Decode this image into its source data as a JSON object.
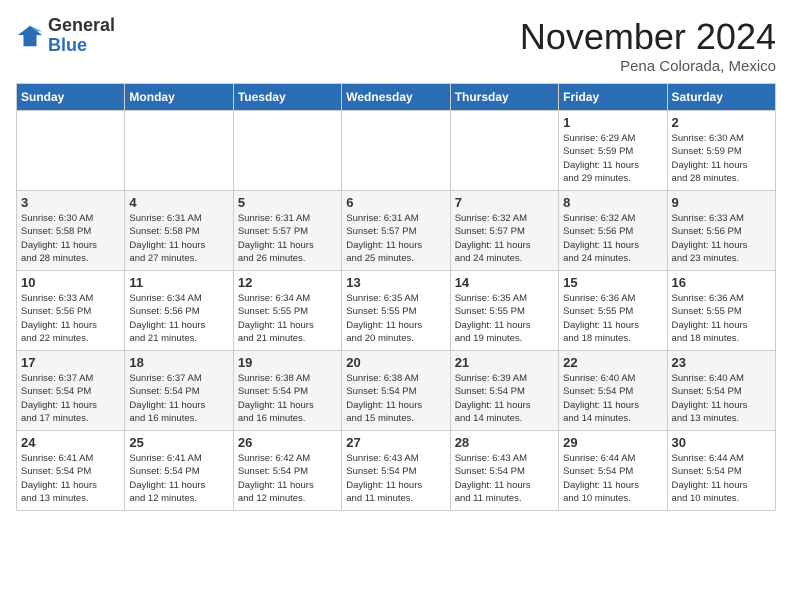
{
  "logo": {
    "general": "General",
    "blue": "Blue"
  },
  "title": "November 2024",
  "subtitle": "Pena Colorada, Mexico",
  "days_of_week": [
    "Sunday",
    "Monday",
    "Tuesday",
    "Wednesday",
    "Thursday",
    "Friday",
    "Saturday"
  ],
  "weeks": [
    [
      {
        "day": "",
        "info": ""
      },
      {
        "day": "",
        "info": ""
      },
      {
        "day": "",
        "info": ""
      },
      {
        "day": "",
        "info": ""
      },
      {
        "day": "",
        "info": ""
      },
      {
        "day": "1",
        "info": "Sunrise: 6:29 AM\nSunset: 5:59 PM\nDaylight: 11 hours\nand 29 minutes."
      },
      {
        "day": "2",
        "info": "Sunrise: 6:30 AM\nSunset: 5:59 PM\nDaylight: 11 hours\nand 28 minutes."
      }
    ],
    [
      {
        "day": "3",
        "info": "Sunrise: 6:30 AM\nSunset: 5:58 PM\nDaylight: 11 hours\nand 28 minutes."
      },
      {
        "day": "4",
        "info": "Sunrise: 6:31 AM\nSunset: 5:58 PM\nDaylight: 11 hours\nand 27 minutes."
      },
      {
        "day": "5",
        "info": "Sunrise: 6:31 AM\nSunset: 5:57 PM\nDaylight: 11 hours\nand 26 minutes."
      },
      {
        "day": "6",
        "info": "Sunrise: 6:31 AM\nSunset: 5:57 PM\nDaylight: 11 hours\nand 25 minutes."
      },
      {
        "day": "7",
        "info": "Sunrise: 6:32 AM\nSunset: 5:57 PM\nDaylight: 11 hours\nand 24 minutes."
      },
      {
        "day": "8",
        "info": "Sunrise: 6:32 AM\nSunset: 5:56 PM\nDaylight: 11 hours\nand 24 minutes."
      },
      {
        "day": "9",
        "info": "Sunrise: 6:33 AM\nSunset: 5:56 PM\nDaylight: 11 hours\nand 23 minutes."
      }
    ],
    [
      {
        "day": "10",
        "info": "Sunrise: 6:33 AM\nSunset: 5:56 PM\nDaylight: 11 hours\nand 22 minutes."
      },
      {
        "day": "11",
        "info": "Sunrise: 6:34 AM\nSunset: 5:56 PM\nDaylight: 11 hours\nand 21 minutes."
      },
      {
        "day": "12",
        "info": "Sunrise: 6:34 AM\nSunset: 5:55 PM\nDaylight: 11 hours\nand 21 minutes."
      },
      {
        "day": "13",
        "info": "Sunrise: 6:35 AM\nSunset: 5:55 PM\nDaylight: 11 hours\nand 20 minutes."
      },
      {
        "day": "14",
        "info": "Sunrise: 6:35 AM\nSunset: 5:55 PM\nDaylight: 11 hours\nand 19 minutes."
      },
      {
        "day": "15",
        "info": "Sunrise: 6:36 AM\nSunset: 5:55 PM\nDaylight: 11 hours\nand 18 minutes."
      },
      {
        "day": "16",
        "info": "Sunrise: 6:36 AM\nSunset: 5:55 PM\nDaylight: 11 hours\nand 18 minutes."
      }
    ],
    [
      {
        "day": "17",
        "info": "Sunrise: 6:37 AM\nSunset: 5:54 PM\nDaylight: 11 hours\nand 17 minutes."
      },
      {
        "day": "18",
        "info": "Sunrise: 6:37 AM\nSunset: 5:54 PM\nDaylight: 11 hours\nand 16 minutes."
      },
      {
        "day": "19",
        "info": "Sunrise: 6:38 AM\nSunset: 5:54 PM\nDaylight: 11 hours\nand 16 minutes."
      },
      {
        "day": "20",
        "info": "Sunrise: 6:38 AM\nSunset: 5:54 PM\nDaylight: 11 hours\nand 15 minutes."
      },
      {
        "day": "21",
        "info": "Sunrise: 6:39 AM\nSunset: 5:54 PM\nDaylight: 11 hours\nand 14 minutes."
      },
      {
        "day": "22",
        "info": "Sunrise: 6:40 AM\nSunset: 5:54 PM\nDaylight: 11 hours\nand 14 minutes."
      },
      {
        "day": "23",
        "info": "Sunrise: 6:40 AM\nSunset: 5:54 PM\nDaylight: 11 hours\nand 13 minutes."
      }
    ],
    [
      {
        "day": "24",
        "info": "Sunrise: 6:41 AM\nSunset: 5:54 PM\nDaylight: 11 hours\nand 13 minutes."
      },
      {
        "day": "25",
        "info": "Sunrise: 6:41 AM\nSunset: 5:54 PM\nDaylight: 11 hours\nand 12 minutes."
      },
      {
        "day": "26",
        "info": "Sunrise: 6:42 AM\nSunset: 5:54 PM\nDaylight: 11 hours\nand 12 minutes."
      },
      {
        "day": "27",
        "info": "Sunrise: 6:43 AM\nSunset: 5:54 PM\nDaylight: 11 hours\nand 11 minutes."
      },
      {
        "day": "28",
        "info": "Sunrise: 6:43 AM\nSunset: 5:54 PM\nDaylight: 11 hours\nand 11 minutes."
      },
      {
        "day": "29",
        "info": "Sunrise: 6:44 AM\nSunset: 5:54 PM\nDaylight: 11 hours\nand 10 minutes."
      },
      {
        "day": "30",
        "info": "Sunrise: 6:44 AM\nSunset: 5:54 PM\nDaylight: 11 hours\nand 10 minutes."
      }
    ]
  ]
}
